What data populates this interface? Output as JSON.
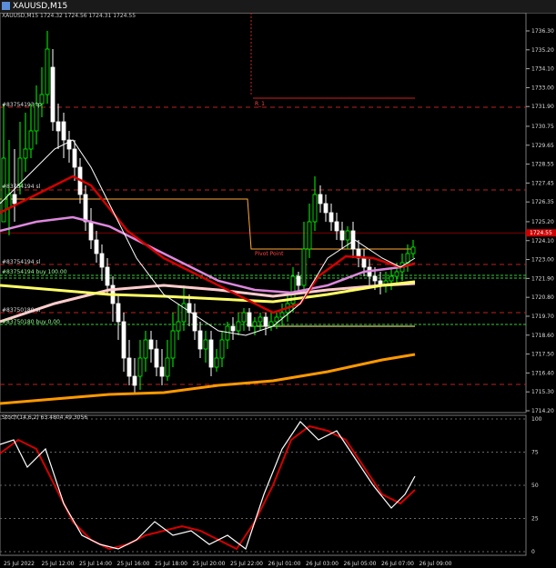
{
  "window": {
    "title": "XAUUSD,M15",
    "price_line_text": "XAUUSD,M15  1724.32 1724.56 1724.31 1724.55"
  },
  "price_axis": {
    "ticks": [
      "1736.30",
      "1735.20",
      "1734.10",
      "1733.00",
      "1731.90",
      "1730.75",
      "1729.65",
      "1728.55",
      "1727.45",
      "1726.35",
      "1725.20",
      "1724.10",
      "1723.00",
      "1721.90",
      "1720.80",
      "1719.70",
      "1718.60",
      "1717.50",
      "1716.40",
      "1715.30",
      "1714.20"
    ],
    "current_price": "1724.55",
    "current_price_color": "#cc0000"
  },
  "time_axis": {
    "labels": [
      "25 Jul 2022",
      "25 Jul 12:00",
      "25 Jul 14:00",
      "25 Jul 16:00",
      "25 Jul 18:00",
      "25 Jul 20:00",
      "25 Jul 22:00",
      "26 Jul 01:00",
      "26 Jul 03:00",
      "26 Jul 05:00",
      "26 Jul 07:00",
      "26 Jul 09:00"
    ]
  },
  "chart_labels": {
    "r1": "R_1",
    "pivot": "Pivot Point",
    "order1": "#83754193 tp",
    "order2": "#83754194 sl",
    "order3": "#83754194 sl",
    "order4": "#83754194 buy 100.00",
    "order5": "#83750180 sl",
    "order6": "#83750180 buy 0.00"
  },
  "indicator": {
    "label": "Stoch(14,6,2) 63.4804 49.3056",
    "levels": [
      "100",
      "75",
      "50",
      "25",
      "0"
    ]
  },
  "colors": {
    "bull": "#00ff00",
    "bear": "#ffffff",
    "ma_red": "#d40000",
    "ma_white": "#ffffff",
    "ma_violet": "#dd88dd",
    "ma_yellow": "#ffff66",
    "ma_orange": "#ff9900",
    "ma_pink": "#ffcccc"
  }
}
